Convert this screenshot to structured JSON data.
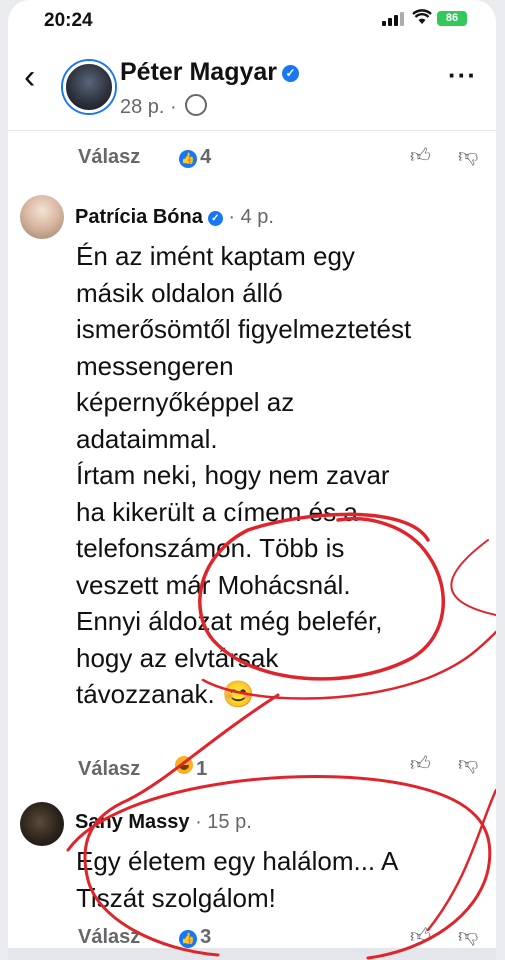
{
  "status_bar": {
    "time": "20:24",
    "battery": "86"
  },
  "header": {
    "name": "Péter Magyar",
    "meta": "28 p. ·"
  },
  "first_row": {
    "reply": "Válasz",
    "reaction_count": "4"
  },
  "comments": [
    {
      "author": "Patrícia Bóna",
      "time": "· 4 p.",
      "lines": [
        "Én az imént kaptam egy",
        "másik oldalon álló",
        "ismerősömtől figyelmeztetést",
        "messengeren",
        "képernyőképpel az",
        "adataimmal.",
        "Írtam neki, hogy nem zavar",
        "ha kikerült a címem és a",
        "telefonszámon. Több is",
        "veszett már Mohácsnál.",
        "Ennyi áldozat még belefér,",
        "hogy az elvtársak",
        "távozzanak. 😊"
      ],
      "reply": "Válasz",
      "reaction_count": "1"
    },
    {
      "author": "Sany Massy",
      "time": "· 15 p.",
      "lines": [
        "Egy életem egy halálom... A",
        "Tiszát szolgálom!"
      ],
      "reply": "Válasz",
      "reaction_count": "3"
    }
  ],
  "colors": {
    "accent": "#1877f2",
    "muted": "#65676b",
    "annotation": "#e0242b"
  }
}
